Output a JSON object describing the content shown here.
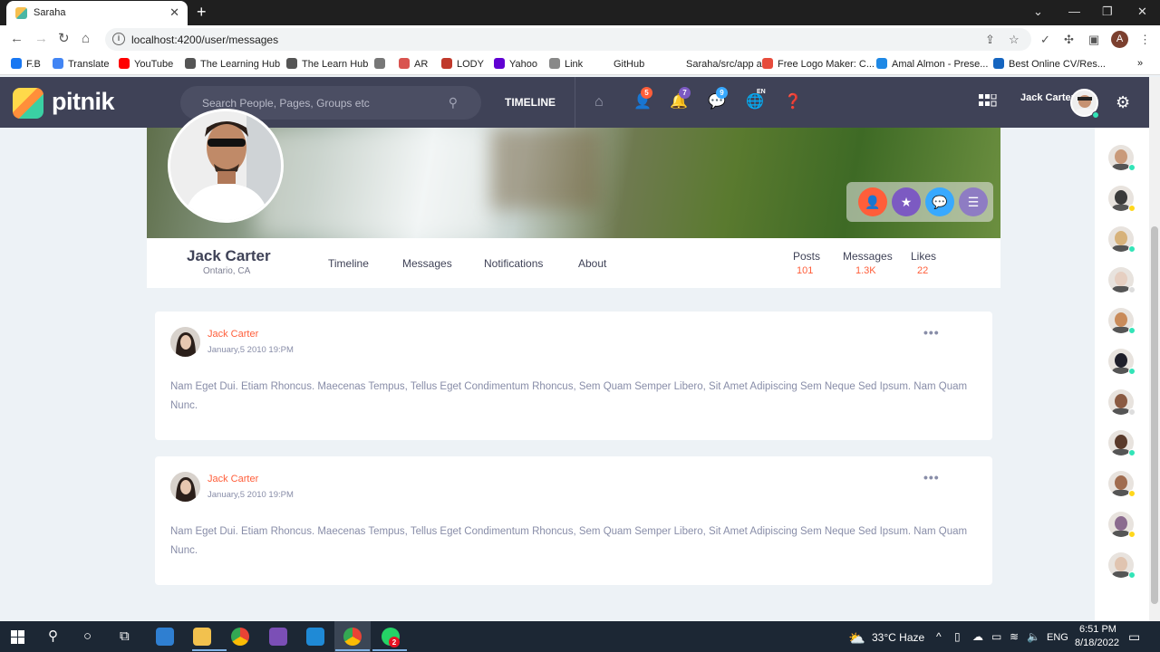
{
  "browser": {
    "tab_title": "Saraha",
    "url": "localhost:4200/user/messages",
    "profile_initial": "A",
    "bookmarks": [
      {
        "label": "F.B",
        "color": "#1877f2"
      },
      {
        "label": "Translate",
        "color": "#4285f4"
      },
      {
        "label": "YouTube",
        "color": "#ff0000"
      },
      {
        "label": "The Learning Hub",
        "color": "#555555"
      },
      {
        "label": "The Learn Hub",
        "color": "#555555"
      },
      {
        "label": "",
        "color": "#777777"
      },
      {
        "label": "AR",
        "color": "#d9534f"
      },
      {
        "label": "LODY",
        "color": "#c0392b"
      },
      {
        "label": "Yahoo",
        "color": "#6001d2"
      },
      {
        "label": "Link",
        "color": "#888888"
      },
      {
        "label": "GitHub",
        "color": "#ffffff"
      },
      {
        "label": "Saraha/src/app at...",
        "color": "#ffffff"
      },
      {
        "label": "Free Logo Maker: C...",
        "color": "#e74c3c"
      },
      {
        "label": "Amal Almon - Prese...",
        "color": "#1e88e5"
      },
      {
        "label": "Best Online CV/Res...",
        "color": "#1565c0"
      }
    ]
  },
  "app": {
    "logo": "pitnik",
    "search_placeholder": "Search People, Pages, Groups etc",
    "timeline_link": "TIMELINE",
    "badges": {
      "friends": "5",
      "notifications": "7",
      "messages": "9"
    },
    "lang": "EN",
    "user_name": "Jack Carter",
    "accent": "#ff5e3a"
  },
  "profile": {
    "name": "Jack Carter",
    "location": "Ontario, CA",
    "tabs": [
      "Timeline",
      "Messages",
      "Notifications",
      "About"
    ],
    "stats": [
      {
        "label": "Posts",
        "value": "101"
      },
      {
        "label": "Messages",
        "value": "1.3K"
      },
      {
        "label": "Likes",
        "value": "22"
      }
    ]
  },
  "posts": [
    {
      "author": "Jack Carter",
      "date": "January,5 2010 19:PM",
      "text": "Nam Eget Dui. Etiam Rhoncus. Maecenas Tempus, Tellus Eget Condimentum Rhoncus, Sem Quam Semper Libero, Sit Amet Adipiscing Sem Neque Sed Ipsum. Nam Quam Nunc."
    },
    {
      "author": "Jack Carter",
      "date": "January,5 2010 19:PM",
      "text": "Nam Eget Dui. Etiam Rhoncus. Maecenas Tempus, Tellus Eget Condimentum Rhoncus, Sem Quam Semper Libero, Sit Amet Adipiscing Sem Neque Sed Ipsum. Nam Quam Nunc."
    }
  ],
  "friends_rail": [
    {
      "status": "#32e4b7",
      "skin": "#c99a7a"
    },
    {
      "status": "#ffd71b",
      "skin": "#3a3a3a"
    },
    {
      "status": "#32e4b7",
      "skin": "#d7b27a"
    },
    {
      "status": "#dddddd",
      "skin": "#e6cfc1"
    },
    {
      "status": "#32e4b7",
      "skin": "#c98b5a"
    },
    {
      "status": "#32e4b7",
      "skin": "#1f1f2a"
    },
    {
      "status": "#dddddd",
      "skin": "#8a5a42"
    },
    {
      "status": "#32e4b7",
      "skin": "#5a3a2a"
    },
    {
      "status": "#ffd71b",
      "skin": "#a06c4f"
    },
    {
      "status": "#ffd71b",
      "skin": "#8b6b8f"
    },
    {
      "status": "#32e4b7",
      "skin": "#e0c4b0"
    }
  ],
  "taskbar": {
    "weather": "33°C  Haze",
    "lang": "ENG",
    "time": "6:51 PM",
    "date": "8/18/2022",
    "whatsapp_badge": "2"
  }
}
